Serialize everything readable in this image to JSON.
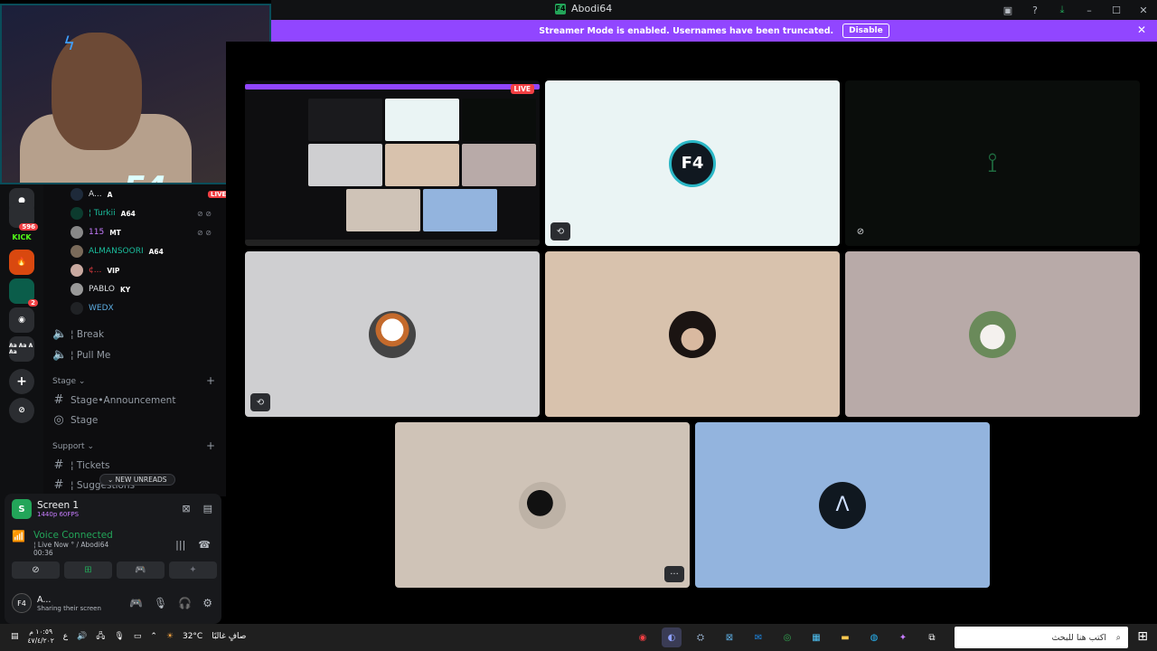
{
  "window": {
    "title": "Abodi64",
    "logo": "F4",
    "controls": [
      "inbox-icon",
      "help-icon",
      "download-icon",
      "minimize-icon",
      "maximize-icon",
      "close-icon"
    ]
  },
  "banner": {
    "message": "Streamer Mode is enabled. Usernames have been truncated.",
    "button_label": "Disable",
    "color": "#9146ff"
  },
  "server_rail": {
    "items": [
      {
        "label": "KICK",
        "color": "#53fc18"
      },
      {
        "label": "596",
        "badge": "596"
      },
      {
        "label": "2",
        "badge": "2"
      },
      {
        "label": "Aa Aa A Aa"
      }
    ]
  },
  "channels": {
    "members": [
      {
        "name": "A...",
        "tag": "A",
        "live": "LIVE"
      },
      {
        "name": "¦ Turkii",
        "tag": "A64"
      },
      {
        "name": "115",
        "tag": "MT"
      },
      {
        "name": "ALMANSOORI",
        "tag": "A64"
      },
      {
        "name": "¢...",
        "tag": "VIP"
      },
      {
        "name": "PABLO",
        "tag": "KY"
      },
      {
        "name": "WEDX",
        "tag": ""
      }
    ],
    "voice_channels": [
      {
        "label": "¦ Break"
      },
      {
        "label": "¦ Pull Me"
      }
    ],
    "stage_category": "Stage",
    "stage_channels": [
      {
        "label": "Stage•Announcement"
      },
      {
        "label": "Stage"
      }
    ],
    "support_category": "Support",
    "support_channels": [
      {
        "label": "¦ Tickets"
      },
      {
        "label": "¦ Suggestions"
      }
    ],
    "new_unreads": "NEW UNREADS"
  },
  "voice_panel": {
    "screen_title": "Screen 1",
    "screen_quality": "1440p 60FPS",
    "status": "Voice Connected",
    "channel": "¦ Live Now ° / Abodi64",
    "timer": "00:36",
    "user_name": "A...",
    "user_status": "Sharing their screen"
  },
  "stage": {
    "live_label": "LIVE",
    "tiles": [
      {
        "name": "tile-screen-share",
        "bg": "#0e0e10"
      },
      {
        "name": "tile-f4",
        "bg": "#eaf4f4"
      },
      {
        "name": "tile-dark-logo",
        "bg": "#0a0d0b"
      },
      {
        "name": "tile-basketball",
        "bg": "#cfcfd1"
      },
      {
        "name": "tile-curly-hair",
        "bg": "#d8c2ad"
      },
      {
        "name": "tile-white-thobe",
        "bg": "#b8aaa8"
      },
      {
        "name": "tile-silhouette",
        "bg": "#cfc3b7"
      },
      {
        "name": "tile-wedx",
        "bg": "#93b4de"
      }
    ]
  },
  "taskbar": {
    "time": "١٠:٥٩ م",
    "date": "٤٧/٤/٢٠٢",
    "weather_temp": "32°C",
    "weather_desc": "صافٍ غالبًا",
    "search_placeholder": "اكتب هنا للبحث"
  }
}
